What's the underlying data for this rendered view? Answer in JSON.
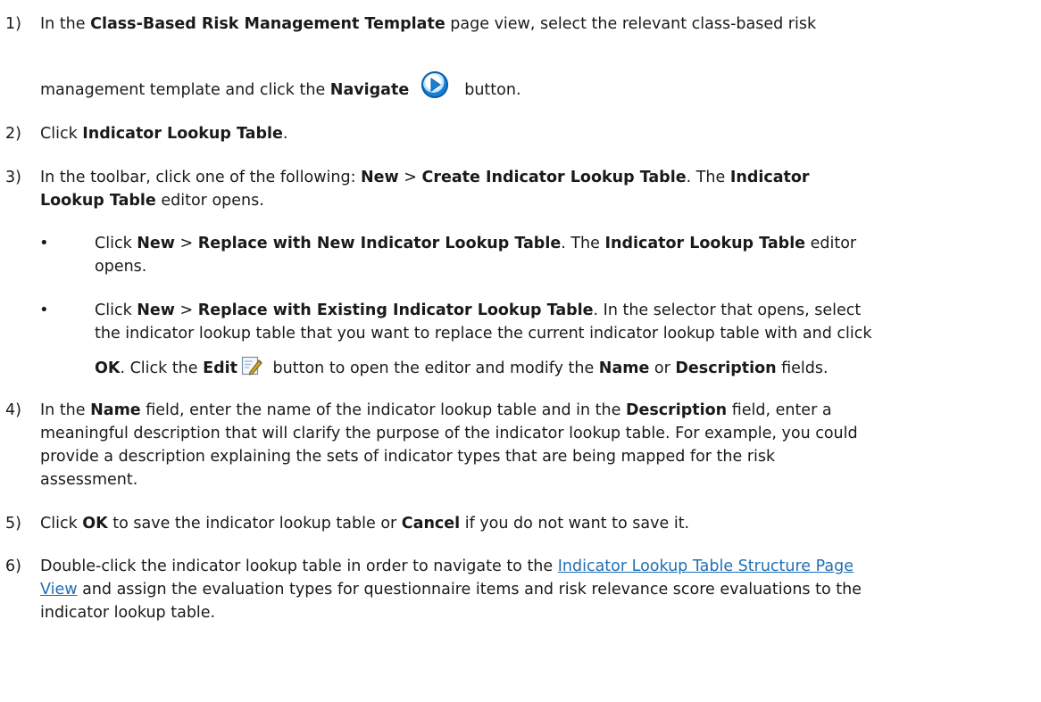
{
  "steps": {
    "s1": {
      "num": "1)",
      "a": "In the ",
      "b1": "Class-Based Risk Management Template",
      "c": " page view, select the relevant class-based risk",
      "d": "management template and click the ",
      "b2": "Navigate",
      "e": "button."
    },
    "s2": {
      "num": "2)",
      "a": "Click ",
      "b1": "Indicator Lookup Table",
      "c": "."
    },
    "s3": {
      "num": "3)",
      "a": "In the toolbar, click one of the following: ",
      "b1": "New",
      "sep": " > ",
      "b2": "Create Indicator Lookup Table",
      "c": ". The ",
      "b3": "Indicator",
      "b4": "Lookup Table",
      "d": " editor opens."
    },
    "bullet1": {
      "a": "Click ",
      "b1": "New",
      "sep": " > ",
      "b2": "Replace with New Indicator Lookup Table",
      "c": ". The ",
      "b3": "Indicator Lookup Table",
      "d": " editor",
      "e": "opens."
    },
    "bullet2": {
      "a": "Click ",
      "b1": "New",
      "sep": " > ",
      "b2": "Replace with Existing Indicator Lookup Table",
      "c": ". In the selector that opens, select",
      "d": "the indicator lookup table that you want to replace the current indicator lookup table with and click",
      "b3": "OK",
      "e": ". Click the ",
      "b4": "Edit",
      "f": " button to open the editor and modify the ",
      "b5": "Name",
      "g": " or ",
      "b6": "Description",
      "h": " fields."
    },
    "s4": {
      "num": "4)",
      "a": "In the ",
      "b1": "Name",
      "c": " field, enter the name of the indicator lookup table and in the ",
      "b2": "Description",
      "d": " field, enter a",
      "l2": "meaningful description that will clarify the purpose of the indicator lookup table. For example, you could",
      "l3": "provide a description explaining the sets of indicator types that are being mapped for the risk",
      "l4": "assessment."
    },
    "s5": {
      "num": "5)",
      "a": "Click ",
      "b1": "OK",
      "c": " to save the indicator lookup table or ",
      "b2": "Cancel",
      "d": " if you do not want to save it."
    },
    "s6": {
      "num": "6)",
      "a": "Double-click the indicator lookup table in order to navigate to the ",
      "link1": "Indicator Lookup Table Structure Page",
      "link2": "View",
      "c": " and assign the evaluation types for questionnaire items and risk relevance score evaluations to the",
      "l3": "indicator lookup table."
    }
  },
  "bullet_glyph": "•",
  "icons": {
    "navigate": "navigate-arrow-icon",
    "edit": "edit-pencil-icon"
  },
  "colors": {
    "link": "#1f6fb4",
    "navigate_blue": "#1a7fd4"
  }
}
